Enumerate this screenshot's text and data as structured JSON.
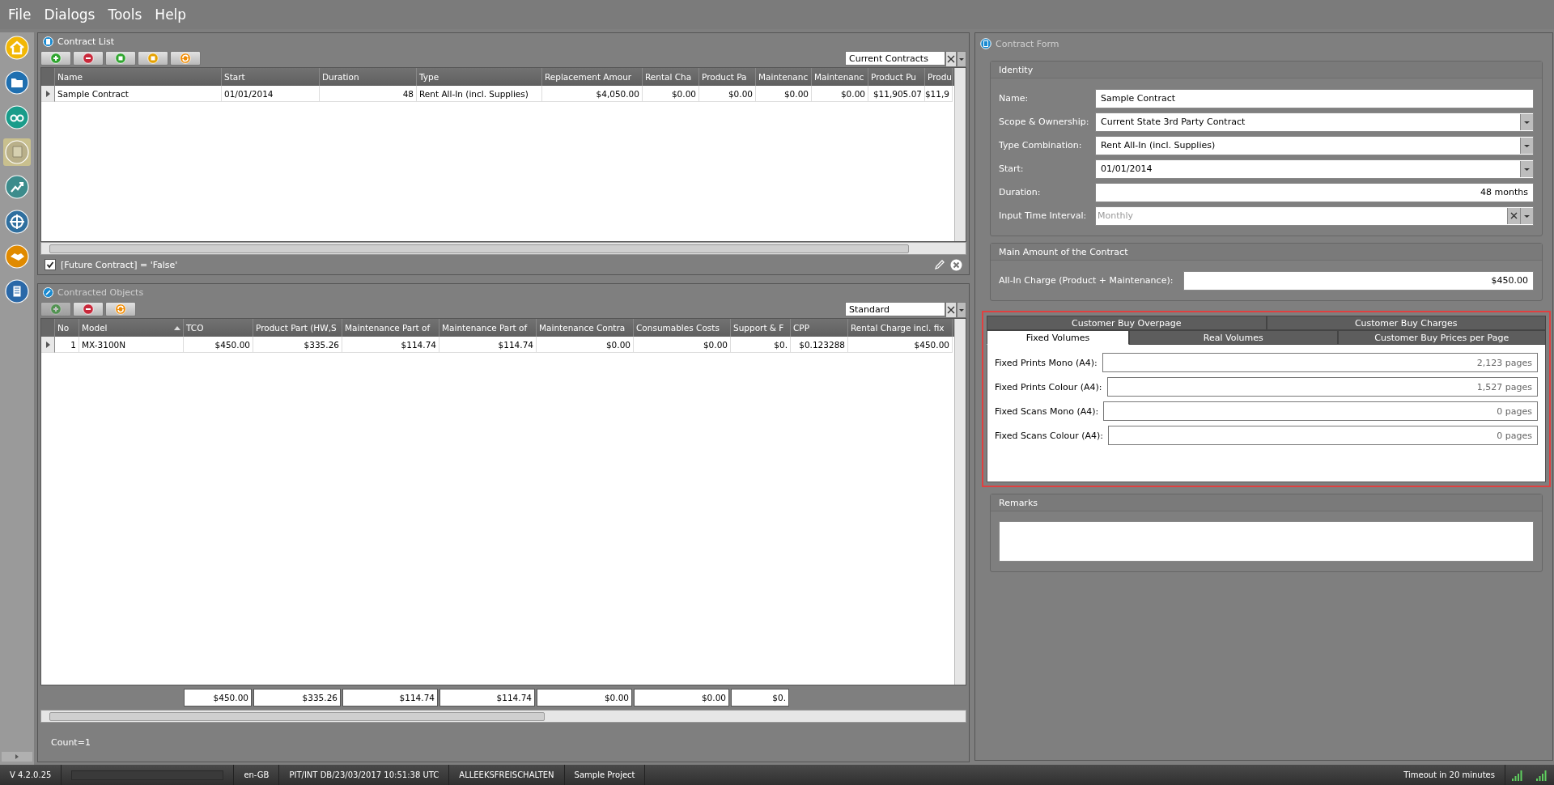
{
  "menu": [
    "File",
    "Dialogs",
    "Tools",
    "Help"
  ],
  "sidebar": [
    {
      "selected": false
    },
    {
      "selected": false
    },
    {
      "selected": false
    },
    {
      "selected": true
    },
    {
      "selected": false
    },
    {
      "selected": false
    },
    {
      "selected": false
    },
    {
      "selected": false
    }
  ],
  "contract_list": {
    "title": "Contract List",
    "view": "Current Contracts",
    "columns": [
      "Name",
      "Start",
      "Duration",
      "Type",
      "Replacement Amour",
      "Rental Cha",
      "Product Pa",
      "Maintenanc",
      "Maintenanc",
      "Product Pu",
      "Produ"
    ],
    "rows": [
      {
        "selected": true,
        "cells": [
          "Sample Contract",
          "01/01/2014",
          "48",
          "Rent All-In (incl. Supplies)",
          "$4,050.00",
          "$0.00",
          "$0.00",
          "$0.00",
          "$0.00",
          "$11,905.07",
          "$11,9"
        ]
      }
    ],
    "filter": {
      "checked": true,
      "text": "[Future Contract] = 'False'"
    }
  },
  "contracted_objects": {
    "title": "Contracted Objects",
    "view": "Standard",
    "toolbar": [
      {
        "disabled": true
      },
      {
        "disabled": false
      },
      {
        "disabled": false
      }
    ],
    "columns": [
      {
        "label": "No",
        "sorted": false
      },
      {
        "label": "Model",
        "sorted": true
      },
      {
        "label": "TCO",
        "sorted": false
      },
      {
        "label": "Product Part (HW,S",
        "sorted": false
      },
      {
        "label": "Maintenance Part of",
        "sorted": false
      },
      {
        "label": "Maintenance Part of",
        "sorted": false
      },
      {
        "label": "Maintenance Contra",
        "sorted": false
      },
      {
        "label": "Consumables Costs",
        "sorted": false
      },
      {
        "label": "Support & F",
        "sorted": false
      },
      {
        "label": "CPP",
        "sorted": false
      },
      {
        "label": "Rental Charge incl. fix",
        "sorted": false
      }
    ],
    "rows": [
      {
        "selected": true,
        "cells": [
          "1",
          "MX-3100N",
          "$450.00",
          "$335.26",
          "$114.74",
          "$114.74",
          "$0.00",
          "$0.00",
          "$0.",
          "$0.123288",
          "$450.00"
        ]
      }
    ],
    "totals": [
      "$450.00",
      "$335.26",
      "$114.74",
      "$114.74",
      "$0.00",
      "$0.00",
      "$0."
    ],
    "count": "Count=1"
  },
  "contract_form": {
    "title": "Contract Form",
    "identity": {
      "title": "Identity",
      "fields": [
        {
          "label": "Name:",
          "value": "Sample Contract",
          "kind": "text"
        },
        {
          "label": "Scope & Ownership:",
          "value": "Current State 3rd Party Contract",
          "kind": "dropdown"
        },
        {
          "label": "Type Combination:",
          "value": "Rent All-In (incl. Supplies)",
          "kind": "dropdown"
        },
        {
          "label": "Start:",
          "value": "01/01/2014",
          "kind": "date"
        },
        {
          "label": "Duration:",
          "value": "48 months",
          "kind": "number"
        },
        {
          "label": "Input Time Interval:",
          "placeholder": "Monthly",
          "kind": "clearable"
        }
      ]
    },
    "main_amount": {
      "title": "Main Amount of the Contract",
      "fields": [
        {
          "label": "All-In Charge (Product + Maintenance):",
          "value": "$450.00",
          "kind": "number"
        }
      ]
    },
    "tab_rows": [
      [
        {
          "label": "Customer Buy Overpage",
          "selected": false
        },
        {
          "label": "Customer Buy Charges",
          "selected": false
        }
      ],
      [
        {
          "label": "Fixed Volumes",
          "selected": true
        },
        {
          "label": "Real Volumes",
          "selected": false
        },
        {
          "label": "Customer Buy Prices per Page",
          "selected": false
        }
      ]
    ],
    "volumes": [
      {
        "label": "Fixed Prints Mono (A4):",
        "value": "2,123 pages"
      },
      {
        "label": "Fixed Prints Colour (A4):",
        "value": "1,527 pages"
      },
      {
        "label": "Fixed Scans Mono (A4):",
        "value": "0 pages"
      },
      {
        "label": "Fixed Scans Colour (A4):",
        "value": "0 pages"
      }
    ],
    "remarks": {
      "title": "Remarks"
    }
  },
  "status_bar": {
    "version": "V 4.2.0.25",
    "progress": {
      "level": 0
    },
    "locale": "en-GB",
    "database": "PIT/INT DB/23/03/2017 10:51:38 UTC",
    "user": "ALLEEKSFREISCHALTEN",
    "project": "Sample Project",
    "timeout": "Timeout in 20 minutes"
  }
}
